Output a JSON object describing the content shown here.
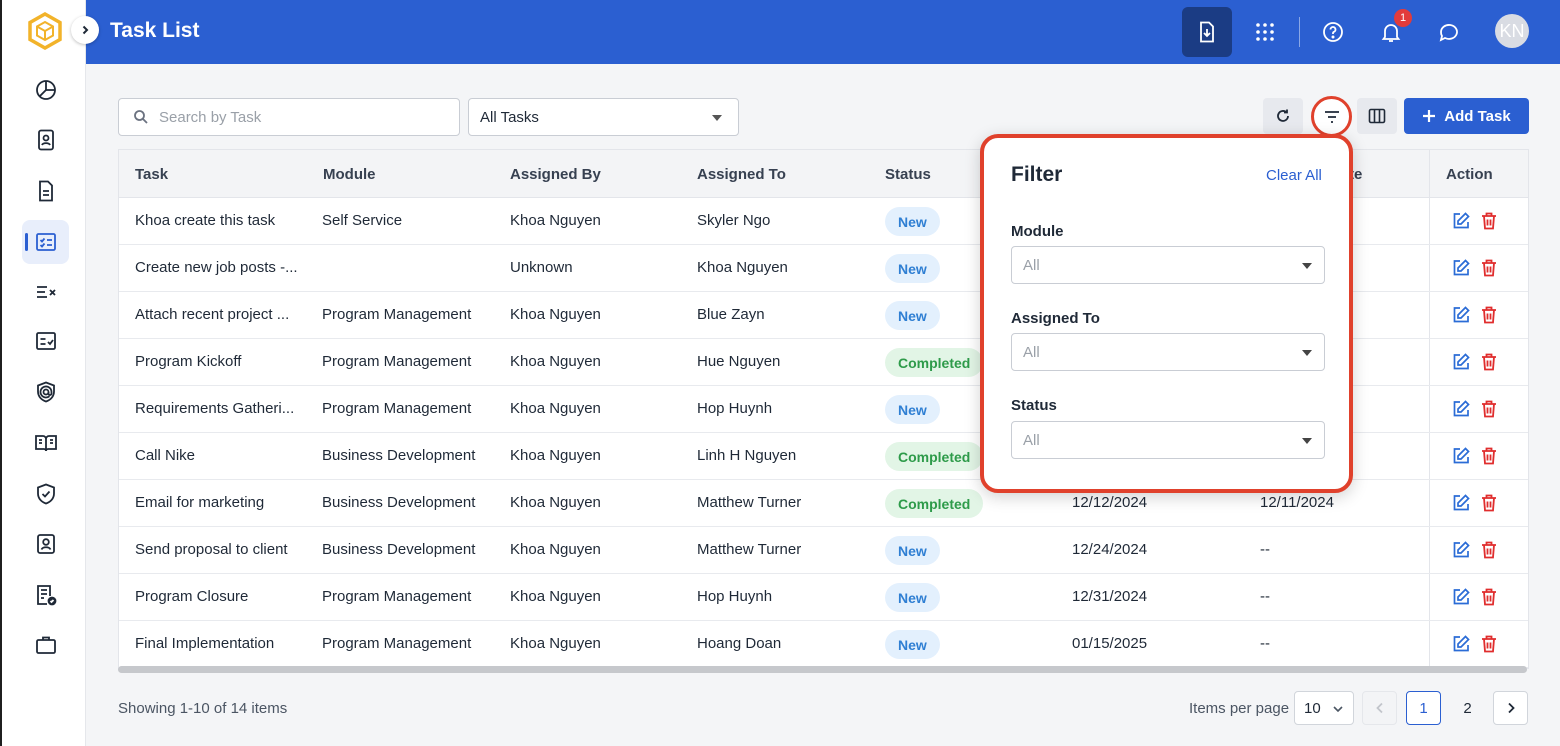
{
  "header": {
    "title": "Task List",
    "notification_count": "1",
    "avatar_initials": "KN"
  },
  "sidebar": {
    "items": [
      {
        "icon": "pie-chart-icon"
      },
      {
        "icon": "id-card-icon"
      },
      {
        "icon": "document-icon"
      },
      {
        "icon": "task-list-icon",
        "active": true
      },
      {
        "icon": "checklist-x-icon"
      },
      {
        "icon": "checkbox-list-icon"
      },
      {
        "icon": "shield-at-icon"
      },
      {
        "icon": "open-book-icon"
      },
      {
        "icon": "shield-check-icon"
      },
      {
        "icon": "contact-card-icon"
      },
      {
        "icon": "doc-check-icon"
      },
      {
        "icon": "briefcase-icon"
      }
    ]
  },
  "toolbar": {
    "search_placeholder": "Search by Task",
    "task_filter_value": "All Tasks",
    "add_task_label": "Add Task"
  },
  "table": {
    "columns": [
      "Task",
      "Module",
      "Assigned By",
      "Assigned To",
      "Status",
      "Action"
    ],
    "partial_column": "te",
    "rows": [
      {
        "task": "Khoa create this task",
        "module": "Self Service",
        "assigned_by": "Khoa Nguyen",
        "assigned_to": "Skyler Ngo",
        "status": "New",
        "date1": "",
        "date2": ""
      },
      {
        "task": "Create new job posts -...",
        "module": "",
        "assigned_by": "Unknown",
        "assigned_to": "Khoa Nguyen",
        "status": "New",
        "date1": "",
        "date2": ""
      },
      {
        "task": "Attach recent project ...",
        "module": "Program Management",
        "assigned_by": "Khoa Nguyen",
        "assigned_to": "Blue Zayn",
        "status": "New",
        "date1": "",
        "date2": ""
      },
      {
        "task": "Program Kickoff",
        "module": "Program Management",
        "assigned_by": "Khoa Nguyen",
        "assigned_to": "Hue Nguyen",
        "status": "Completed",
        "date1": "",
        "date2": ""
      },
      {
        "task": "Requirements Gatheri...",
        "module": "Program Management",
        "assigned_by": "Khoa Nguyen",
        "assigned_to": "Hop Huynh",
        "status": "New",
        "date1": "",
        "date2": ""
      },
      {
        "task": "Call Nike",
        "module": "Business Development",
        "assigned_by": "Khoa Nguyen",
        "assigned_to": "Linh H Nguyen",
        "status": "Completed",
        "date1": "",
        "date2": ""
      },
      {
        "task": "Email for marketing",
        "module": "Business Development",
        "assigned_by": "Khoa Nguyen",
        "assigned_to": "Matthew Turner",
        "status": "Completed",
        "date1": "12/12/2024",
        "date2": "12/11/2024"
      },
      {
        "task": "Send proposal to client",
        "module": "Business Development",
        "assigned_by": "Khoa Nguyen",
        "assigned_to": "Matthew Turner",
        "status": "New",
        "date1": "12/24/2024",
        "date2": "--"
      },
      {
        "task": "Program Closure",
        "module": "Program Management",
        "assigned_by": "Khoa Nguyen",
        "assigned_to": "Hop Huynh",
        "status": "New",
        "date1": "12/31/2024",
        "date2": "--"
      },
      {
        "task": "Final Implementation",
        "module": "Program Management",
        "assigned_by": "Khoa Nguyen",
        "assigned_to": "Hoang Doan",
        "status": "New",
        "date1": "01/15/2025",
        "date2": "--"
      }
    ]
  },
  "footer": {
    "showing_text": "Showing 1-10 of 14 items",
    "items_per_page_label": "Items per page",
    "items_per_page_value": "10",
    "pages": [
      "1",
      "2"
    ],
    "current_page": "1"
  },
  "filter_panel": {
    "title": "Filter",
    "clear_all": "Clear All",
    "fields": [
      {
        "label": "Module",
        "value": "All"
      },
      {
        "label": "Assigned To",
        "value": "All"
      },
      {
        "label": "Status",
        "value": "All"
      }
    ]
  },
  "colors": {
    "primary": "#2b5fd1",
    "highlight": "#e0412c",
    "new_badge": "#2f7fd3",
    "completed_badge": "#2e9b4a",
    "delete": "#e02d2d"
  }
}
